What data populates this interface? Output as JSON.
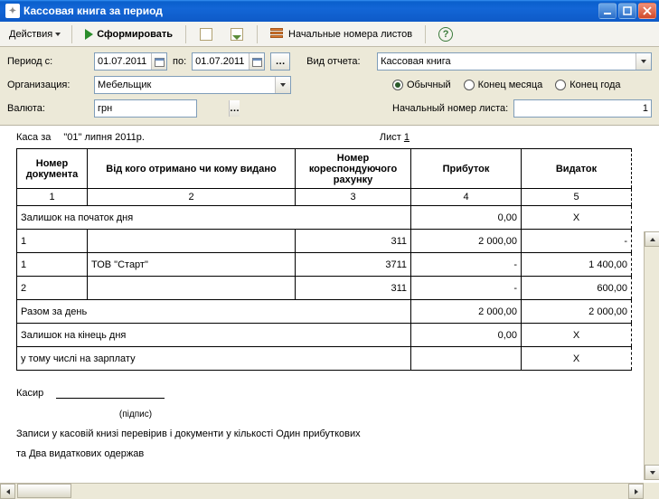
{
  "window": {
    "title": "Кассовая книга за период"
  },
  "toolbar": {
    "actions_label": "Действия",
    "form_label": "Сформировать",
    "initial_numbers_label": "Начальные номера листов"
  },
  "filters": {
    "period_from_label": "Период с:",
    "period_from_value": "01.07.2011",
    "period_to_label": "по:",
    "period_to_value": "01.07.2011",
    "report_type_label": "Вид отчета:",
    "report_type_value": "Кассовая книга",
    "org_label": "Организация:",
    "org_value": "Мебельщик",
    "mode_options": {
      "usual": "Обычный",
      "month_end": "Конец месяца",
      "year_end": "Конец года"
    },
    "mode_selected": "usual",
    "currency_label": "Валюта:",
    "currency_value": "грн",
    "start_page_label": "Начальный номер листа:",
    "start_page_value": "1"
  },
  "report": {
    "kasa_lbl": "Каса за",
    "kasa_date": "\"01\" липня 2011р.",
    "list_lbl": "Лист",
    "list_no": "1",
    "headers": {
      "c1": "Номер документа",
      "c2": "Від кого отримано чи кому видано",
      "c3": "Номер кореспондуючого рахунку",
      "c4": "Прибуток",
      "c5": "Видаток"
    },
    "col_index": {
      "c1": "1",
      "c2": "2",
      "c3": "3",
      "c4": "4",
      "c5": "5"
    },
    "rows": [
      {
        "doc": "",
        "who": "Залишок на початок дня",
        "acct": "",
        "in": "0,00",
        "out": "Х",
        "span": true
      },
      {
        "doc": "1",
        "who": "",
        "acct": "311",
        "in": "2 000,00",
        "out": "-"
      },
      {
        "doc": "1",
        "who": "ТОВ \"Старт\"",
        "acct": "3711",
        "in": "-",
        "out": "1 400,00"
      },
      {
        "doc": "2",
        "who": "",
        "acct": "311",
        "in": "-",
        "out": "600,00"
      },
      {
        "doc": "",
        "who": "Разом за день",
        "acct": "",
        "in": "2 000,00",
        "out": "2 000,00",
        "span": true
      },
      {
        "doc": "",
        "who": "Залишок на кінець дня",
        "acct": "",
        "in": "0,00",
        "out": "Х",
        "span": true
      },
      {
        "doc": "",
        "who": "у тому числі на зарплату",
        "acct": "",
        "in": "",
        "out": "Х",
        "span": true
      }
    ],
    "signer_label": "Касир",
    "signer_caption": "(підпис)",
    "footer_text_1": "Записи у касовій книзі перевірив і документи у кількості Один прибуткових",
    "footer_text_2": "та Два видаткових одержав"
  }
}
